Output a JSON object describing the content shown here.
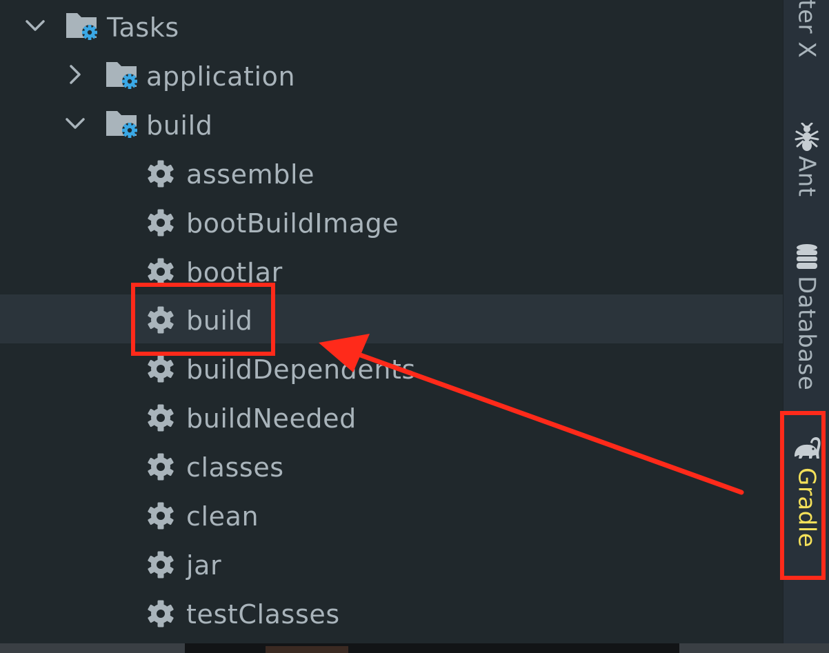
{
  "tree": {
    "root": {
      "label": "Tasks",
      "expanded": true,
      "icon": "folder-gear-icon"
    },
    "groups": [
      {
        "label": "application",
        "expanded": false,
        "icon": "folder-gear-icon"
      },
      {
        "label": "build",
        "expanded": true,
        "icon": "folder-gear-icon"
      }
    ],
    "tasks": [
      {
        "label": "assemble",
        "icon": "gear-icon"
      },
      {
        "label": "bootBuildImage",
        "icon": "gear-icon"
      },
      {
        "label": "bootJar",
        "icon": "gear-icon"
      },
      {
        "label": "build",
        "icon": "gear-icon",
        "selected": true
      },
      {
        "label": "buildDependents",
        "icon": "gear-icon"
      },
      {
        "label": "buildNeeded",
        "icon": "gear-icon"
      },
      {
        "label": "classes",
        "icon": "gear-icon"
      },
      {
        "label": "clean",
        "icon": "gear-icon"
      },
      {
        "label": "jar",
        "icon": "gear-icon"
      },
      {
        "label": "testClasses",
        "icon": "gear-icon"
      }
    ]
  },
  "right_bar": {
    "tabs": [
      {
        "label": "oter X",
        "icon": ""
      },
      {
        "label": "Ant",
        "icon": "ant-icon"
      },
      {
        "label": "Database",
        "icon": "database-icon"
      },
      {
        "label": "Gradle",
        "icon": "gradle-elephant-icon",
        "active": true
      }
    ]
  },
  "colors": {
    "background": "#20282c",
    "text": "#a9b4bb",
    "selected_row": "#2b343b",
    "gradle_active": "#f5e15a",
    "annotation": "#ff2a1a",
    "folder_badge": "#3aa8e6"
  }
}
